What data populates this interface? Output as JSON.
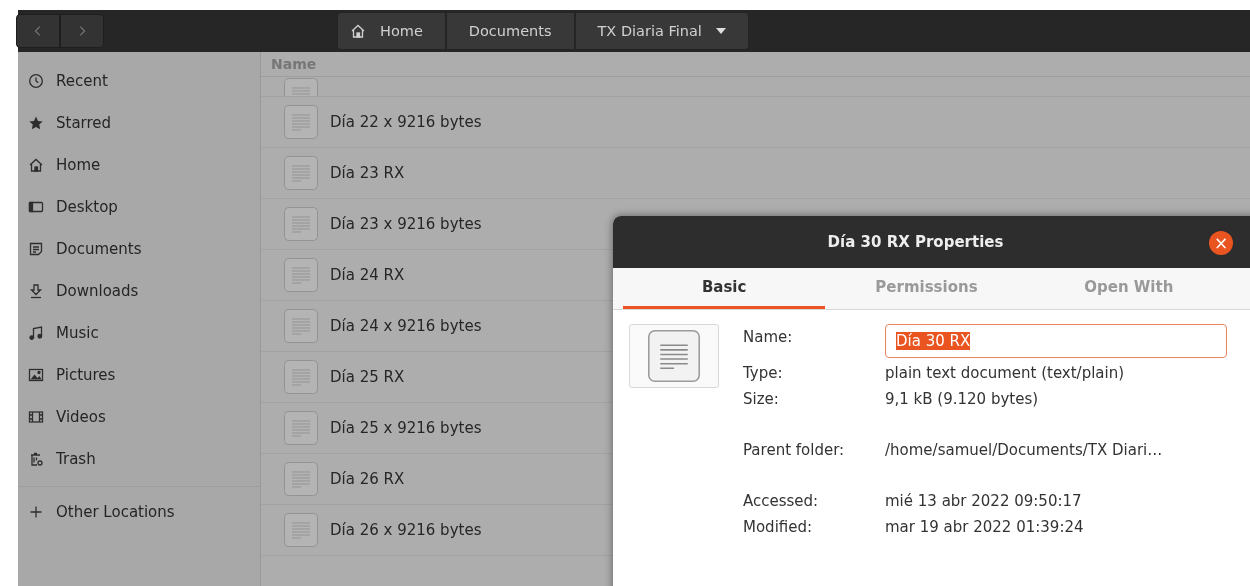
{
  "header_bar": {
    "nav_buttons": [
      {
        "kind": "back",
        "disabled": true
      },
      {
        "kind": "forward",
        "disabled": true
      }
    ],
    "breadcrumbs": [
      {
        "label": "Home",
        "kind": "home"
      },
      {
        "label": "Documents",
        "kind": "folder"
      },
      {
        "label": "TX Diaria Final",
        "kind": "menu"
      }
    ]
  },
  "sidebar": {
    "items": [
      {
        "label": "Recent",
        "kind": "recent"
      },
      {
        "label": "Starred",
        "kind": "starred"
      },
      {
        "label": "Home",
        "kind": "home"
      },
      {
        "label": "Desktop",
        "kind": "desktop"
      },
      {
        "label": "Documents",
        "kind": "documents"
      },
      {
        "label": "Downloads",
        "kind": "downloads"
      },
      {
        "label": "Music",
        "kind": "music"
      },
      {
        "label": "Pictures",
        "kind": "pictures"
      },
      {
        "label": "Videos",
        "kind": "videos"
      },
      {
        "label": "Trash",
        "kind": "trash"
      }
    ],
    "other_locations": {
      "label": "Other Locations"
    }
  },
  "file_list": {
    "columns": [
      "Name"
    ],
    "rows": [
      "Día 22 x 9216 bytes",
      "Día 23 RX",
      "Día 23 x 9216 bytes",
      "Día 24 RX",
      "Día 24 x 9216 bytes",
      "Día 25 RX",
      "Día 25 x 9216 bytes",
      "Día 26 RX",
      "Día 26 x 9216 bytes"
    ]
  },
  "properties_dialog": {
    "title": "Día 30 RX Properties",
    "close": "×",
    "tabs": [
      {
        "label": "Basic",
        "selected": true
      },
      {
        "label": "Permissions",
        "selected": false
      },
      {
        "label": "Open With",
        "selected": false
      }
    ],
    "name_field": {
      "label": "Name:",
      "value": "Día 30 RX",
      "text_selected": true
    },
    "sections": [
      [
        {
          "label": "Type:",
          "value": "plain text document (text/plain)"
        },
        {
          "label": "Size:",
          "value": "9,1 kB (9.120 bytes)"
        }
      ],
      [
        {
          "label": "Parent folder:",
          "value": "/home/samuel/Documents/TX Diari…"
        }
      ],
      [
        {
          "label": "Accessed:",
          "value": "mié 13 abr 2022 09:50:17"
        },
        {
          "label": "Modified:",
          "value": "mar 19 abr 2022 01:39:24"
        }
      ]
    ]
  }
}
